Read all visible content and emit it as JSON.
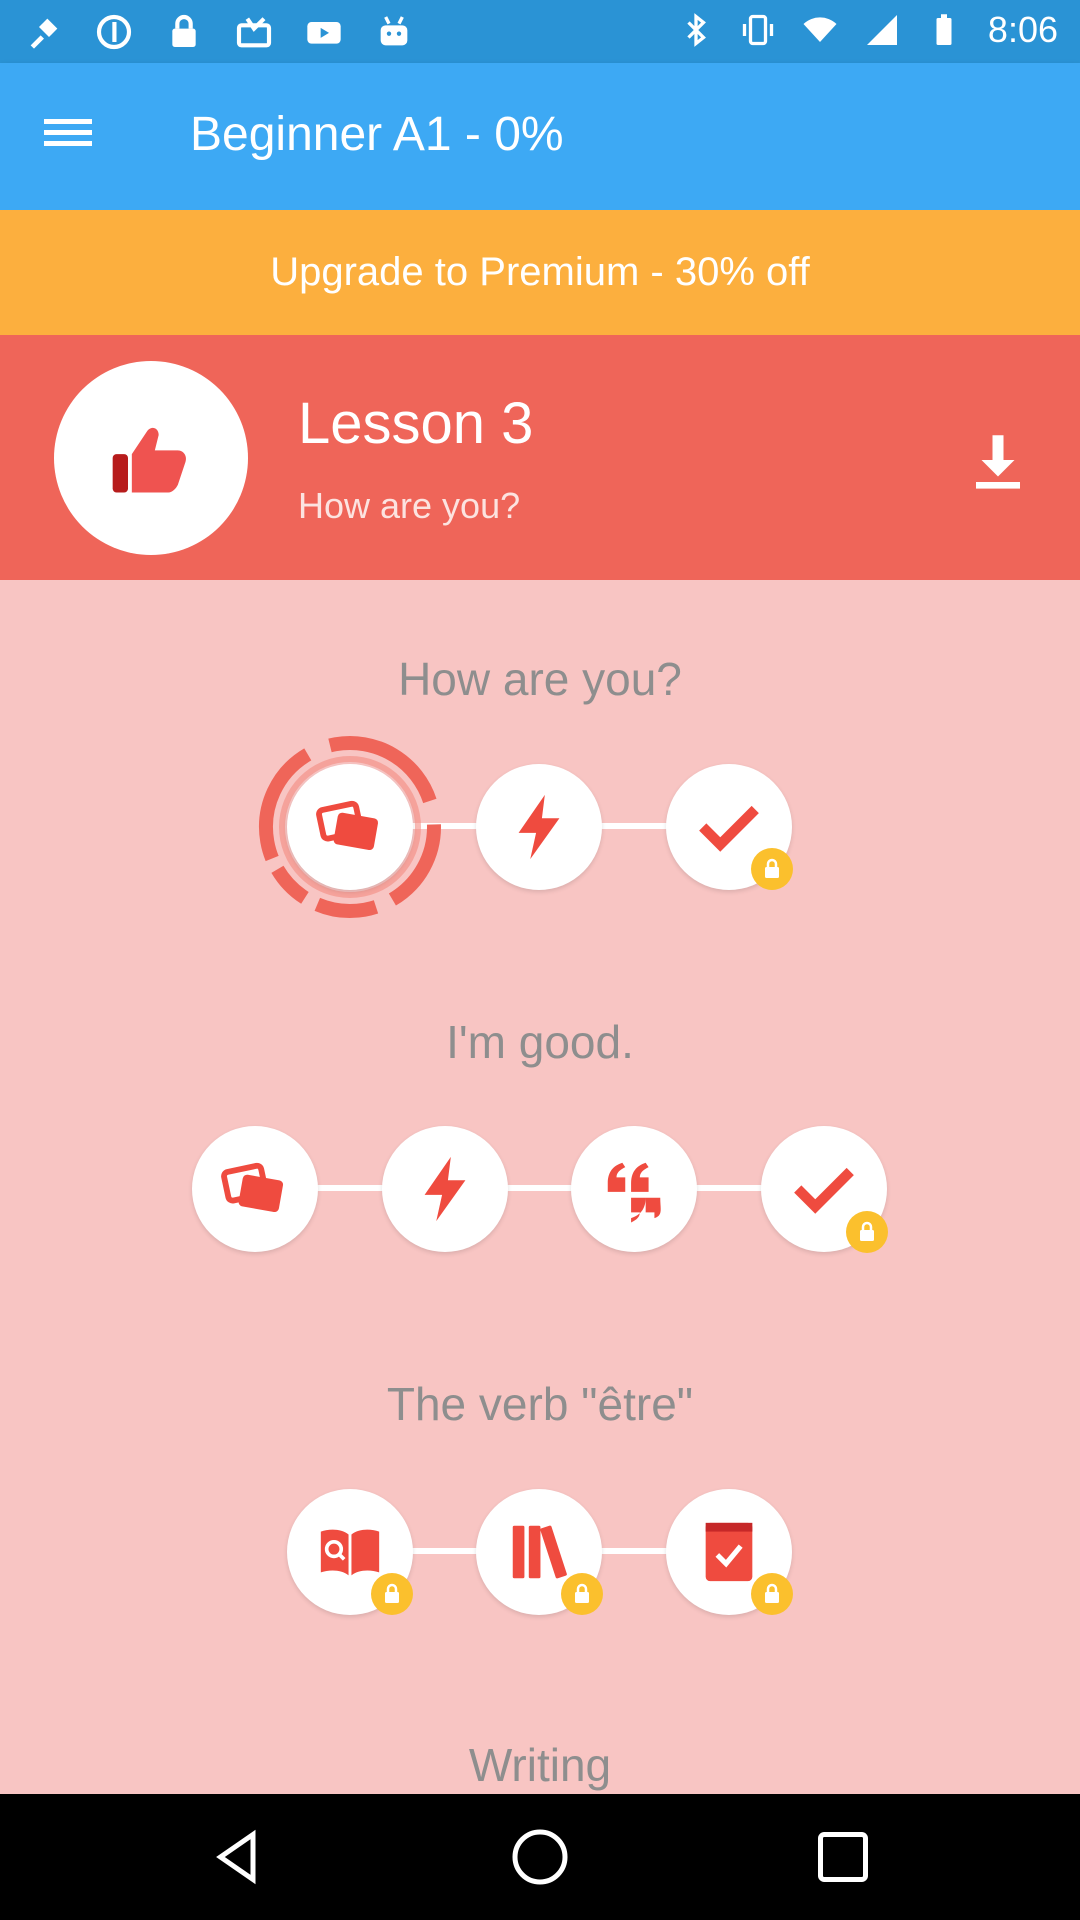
{
  "status_bar": {
    "time": "8:06",
    "left_icons": [
      "fake-gps-icon",
      "data-saver-icon",
      "lock-icon",
      "inbox-icon",
      "youtube-icon",
      "android-icon"
    ],
    "right_icons": [
      "bluetooth-icon",
      "vibrate-icon",
      "wifi-icon",
      "signal-icon",
      "battery-icon"
    ]
  },
  "app_bar": {
    "menu_icon": "hamburger-menu-icon",
    "title": "Beginner A1 - 0%"
  },
  "premium_banner": {
    "label": "Upgrade to Premium - 30% off"
  },
  "lesson": {
    "title": "Lesson 3",
    "subtitle": "How are you?",
    "icon": "thumbs-up-icon",
    "download_icon": "download-icon"
  },
  "sections": [
    {
      "title": "How are you?",
      "steps": [
        {
          "icon": "flashcards-icon",
          "locked": false,
          "in_progress": true
        },
        {
          "icon": "lightning-icon",
          "locked": false
        },
        {
          "icon": "checkmark-icon",
          "locked": true
        }
      ]
    },
    {
      "title": "I'm good.",
      "steps": [
        {
          "icon": "flashcards-icon",
          "locked": false
        },
        {
          "icon": "lightning-icon",
          "locked": false
        },
        {
          "icon": "quote-icon",
          "locked": false
        },
        {
          "icon": "checkmark-icon",
          "locked": true
        }
      ]
    },
    {
      "title": "The verb \"être\"",
      "steps": [
        {
          "icon": "book-search-icon",
          "locked": true
        },
        {
          "icon": "books-icon",
          "locked": true
        },
        {
          "icon": "notebook-check-icon",
          "locked": true
        }
      ]
    },
    {
      "title": "Writing",
      "steps": []
    }
  ],
  "colors": {
    "app_bar": "#3DA9F4",
    "status_bar": "#2A93D5",
    "premium": "#FCAF3E",
    "lesson_header": "#EF6559",
    "background": "#F8C5C3",
    "accent": "#EF4B3F",
    "lock": "#FBC02D"
  },
  "nav_bar": {
    "buttons": [
      "back-icon",
      "home-icon",
      "recents-icon"
    ]
  }
}
